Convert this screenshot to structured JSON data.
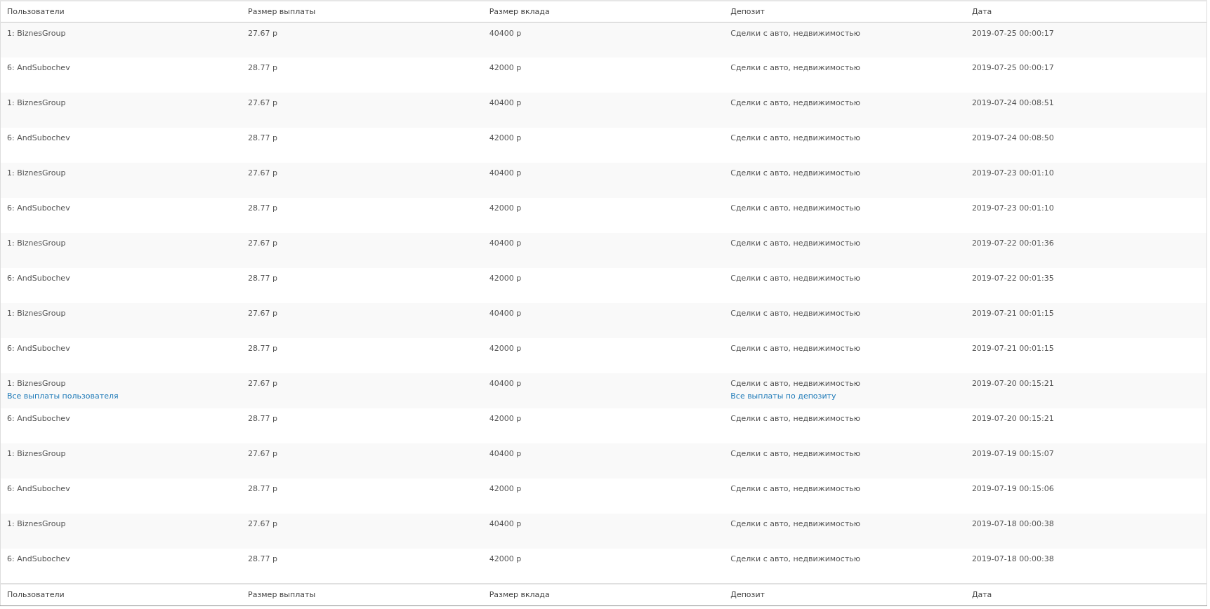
{
  "table": {
    "columns": [
      "Пользователи",
      "Размер выплаты",
      "Размер вклада",
      "Депозит",
      "Дата"
    ],
    "rows": [
      {
        "user": "1: BiznesGroup",
        "payout": "27.67 р",
        "deposit_size": "40400 р",
        "deposit": "Сделки с авто, недвижимостью",
        "date": "2019-07-25 00:00:17"
      },
      {
        "user": "6: AndSubochev",
        "payout": "28.77 р",
        "deposit_size": "42000 р",
        "deposit": "Сделки с авто, недвижимостью",
        "date": "2019-07-25 00:00:17"
      },
      {
        "user": "1: BiznesGroup",
        "payout": "27.67 р",
        "deposit_size": "40400 р",
        "deposit": "Сделки с авто, недвижимостью",
        "date": "2019-07-24 00:08:51"
      },
      {
        "user": "6: AndSubochev",
        "payout": "28.77 р",
        "deposit_size": "42000 р",
        "deposit": "Сделки с авто, недвижимостью",
        "date": "2019-07-24 00:08:50"
      },
      {
        "user": "1: BiznesGroup",
        "payout": "27.67 р",
        "deposit_size": "40400 р",
        "deposit": "Сделки с авто, недвижимостью",
        "date": "2019-07-23 00:01:10"
      },
      {
        "user": "6: AndSubochev",
        "payout": "28.77 р",
        "deposit_size": "42000 р",
        "deposit": "Сделки с авто, недвижимостью",
        "date": "2019-07-23 00:01:10"
      },
      {
        "user": "1: BiznesGroup",
        "payout": "27.67 р",
        "deposit_size": "40400 р",
        "deposit": "Сделки с авто, недвижимостью",
        "date": "2019-07-22 00:01:36"
      },
      {
        "user": "6: AndSubochev",
        "payout": "28.77 р",
        "deposit_size": "42000 р",
        "deposit": "Сделки с авто, недвижимостью",
        "date": "2019-07-22 00:01:35"
      },
      {
        "user": "1: BiznesGroup",
        "payout": "27.67 р",
        "deposit_size": "40400 р",
        "deposit": "Сделки с авто, недвижимостью",
        "date": "2019-07-21 00:01:15"
      },
      {
        "user": "6: AndSubochev",
        "payout": "28.77 р",
        "deposit_size": "42000 р",
        "deposit": "Сделки с авто, недвижимостью",
        "date": "2019-07-21 00:01:15"
      },
      {
        "user": "1: BiznesGroup",
        "user_link": "Все выплаты пользователя",
        "payout": "27.67 р",
        "deposit_size": "40400 р",
        "deposit": "Сделки с авто, недвижимостью",
        "deposit_link": "Все выплаты по депозиту",
        "date": "2019-07-20 00:15:21"
      },
      {
        "user": "6: AndSubochev",
        "payout": "28.77 р",
        "deposit_size": "42000 р",
        "deposit": "Сделки с авто, недвижимостью",
        "date": "2019-07-20 00:15:21"
      },
      {
        "user": "1: BiznesGroup",
        "payout": "27.67 р",
        "deposit_size": "40400 р",
        "deposit": "Сделки с авто, недвижимостью",
        "date": "2019-07-19 00:15:07"
      },
      {
        "user": "6: AndSubochev",
        "payout": "28.77 р",
        "deposit_size": "42000 р",
        "deposit": "Сделки с авто, недвижимостью",
        "date": "2019-07-19 00:15:06"
      },
      {
        "user": "1: BiznesGroup",
        "payout": "27.67 р",
        "deposit_size": "40400 р",
        "deposit": "Сделки с авто, недвижимостью",
        "date": "2019-07-18 00:00:38"
      },
      {
        "user": "6: AndSubochev",
        "payout": "28.77 р",
        "deposit_size": "42000 р",
        "deposit": "Сделки с авто, недвижимостью",
        "date": "2019-07-18 00:00:38"
      }
    ],
    "footer_columns": [
      "Пользователи",
      "Размер выплаты",
      "Размер вклада",
      "Депозит",
      "Дата"
    ]
  }
}
